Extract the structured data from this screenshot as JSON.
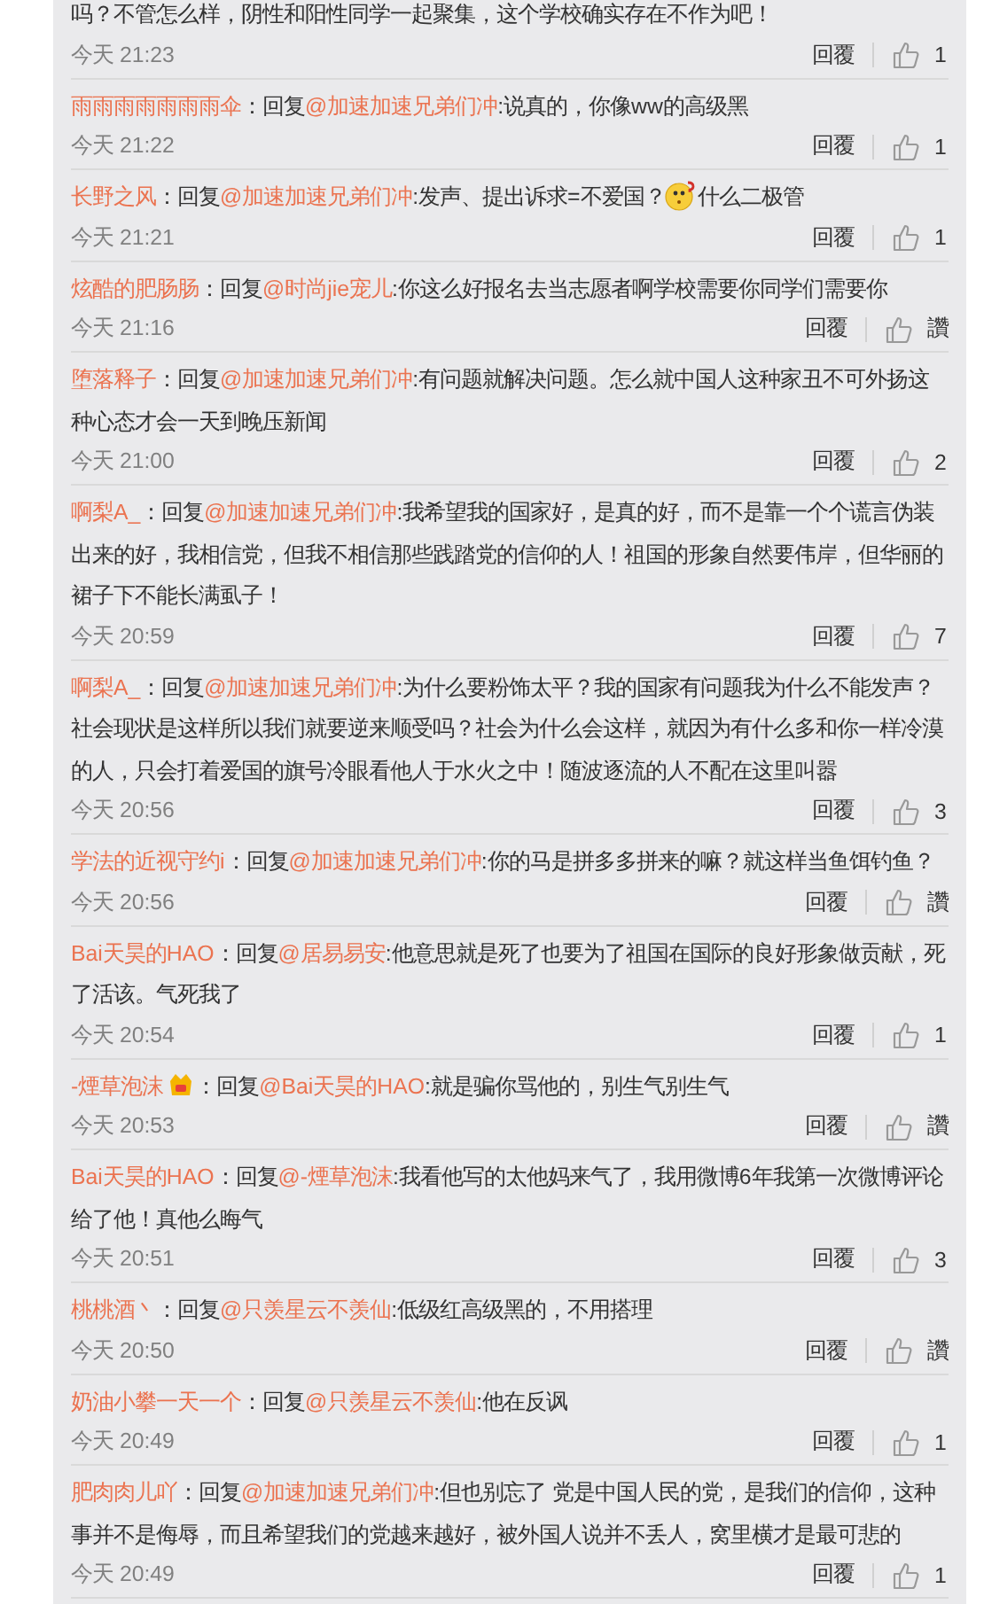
{
  "comments": [
    {
      "body": [
        {
          "kind": "text",
          "text": "吗？不管怎么样，阴性和阳性同学一起聚集，这个学校确实存在不作为吧！"
        }
      ],
      "time": "今天 21:23",
      "reply": "回覆",
      "likes": "1"
    },
    {
      "user": "雨雨雨雨雨雨雨伞",
      "user_badge": false,
      "prefix": "：回复",
      "mention": "@加速加速兄弟们冲",
      "body": [
        {
          "kind": "text",
          "text": ":说真的，你像ww的高级黑"
        }
      ],
      "time": "今天 21:22",
      "reply": "回覆",
      "likes": "1"
    },
    {
      "user": "长野之风",
      "user_badge": false,
      "prefix": "：回复",
      "mention": "@加速加速兄弟们冲",
      "body": [
        {
          "kind": "text",
          "text": ":发声、提出诉求=不爱国？"
        },
        {
          "kind": "emoticon"
        },
        {
          "kind": "text",
          "text": "什么二极管"
        }
      ],
      "time": "今天 21:21",
      "reply": "回覆",
      "likes": "1"
    },
    {
      "user": "炫酷的肥肠肠",
      "user_badge": false,
      "prefix": "：回复",
      "mention": "@时尚jie宠儿",
      "body": [
        {
          "kind": "text",
          "text": ":你这么好报名去当志愿者啊学校需要你同学们需要你"
        }
      ],
      "time": "今天 21:16",
      "reply": "回覆",
      "likes": "讚"
    },
    {
      "user": "堕落释子",
      "user_badge": false,
      "prefix": "：回复",
      "mention": "@加速加速兄弟们冲",
      "body": [
        {
          "kind": "text",
          "text": ":有问题就解决问题。怎么就中国人这种家丑不可外扬这种心态才会一天到晚压新闻"
        }
      ],
      "time": "今天 21:00",
      "reply": "回覆",
      "likes": "2"
    },
    {
      "user": "啊梨A_",
      "user_badge": false,
      "prefix": "：回复",
      "mention": "@加速加速兄弟们冲",
      "body": [
        {
          "kind": "text",
          "text": ":我希望我的国家好，是真的好，而不是靠一个个谎言伪装出来的好，我相信党，但我不相信那些践踏党的信仰的人！祖国的形象自然要伟岸，但华丽的裙子下不能长满虱子！"
        }
      ],
      "time": "今天 20:59",
      "reply": "回覆",
      "likes": "7"
    },
    {
      "user": "啊梨A_",
      "user_badge": false,
      "prefix": "：回复",
      "mention": "@加速加速兄弟们冲",
      "body": [
        {
          "kind": "text",
          "text": ":为什么要粉饰太平？我的国家有问题我为什么不能发声？社会现状是这样所以我们就要逆来顺受吗？社会为什么会这样，就因为有什么多和你一样冷漠的人，只会打着爱国的旗号冷眼看他人于水火之中！随波逐流的人不配在这里叫嚣"
        }
      ],
      "time": "今天 20:56",
      "reply": "回覆",
      "likes": "3"
    },
    {
      "user": "学法的近视守约i",
      "user_badge": false,
      "prefix": "：回复",
      "mention": "@加速加速兄弟们冲",
      "body": [
        {
          "kind": "text",
          "text": ":你的马是拼多多拼来的嘛？就这样当鱼饵钓鱼？"
        }
      ],
      "time": "今天 20:56",
      "reply": "回覆",
      "likes": "讚"
    },
    {
      "user": "Bai天昊的HAO",
      "user_badge": false,
      "prefix": "：回复",
      "mention": "@居易易安",
      "body": [
        {
          "kind": "text",
          "text": ":他意思就是死了也要为了祖国在国际的良好形象做贡献，死了活该。气死我了"
        }
      ],
      "time": "今天 20:54",
      "reply": "回覆",
      "likes": "1"
    },
    {
      "user": "-煙草泡沫",
      "user_badge": true,
      "prefix": "：回复",
      "mention": "@Bai天昊的HAO",
      "body": [
        {
          "kind": "text",
          "text": ":就是骗你骂他的，别生气别生气"
        }
      ],
      "time": "今天 20:53",
      "reply": "回覆",
      "likes": "讚"
    },
    {
      "user": "Bai天昊的HAO",
      "user_badge": false,
      "prefix": "：回复",
      "mention": "@-煙草泡沫",
      "body": [
        {
          "kind": "text",
          "text": ":我看他写的太他妈来气了，我用微博6年我第一次微博评论给了他！真他么晦气"
        }
      ],
      "time": "今天 20:51",
      "reply": "回覆",
      "likes": "3"
    },
    {
      "user": "桃桃酒丶",
      "user_badge": false,
      "prefix": "：回复",
      "mention": "@只羡星云不羡仙",
      "body": [
        {
          "kind": "text",
          "text": ":低级红高级黑的，不用搭理"
        }
      ],
      "time": "今天 20:50",
      "reply": "回覆",
      "likes": "讚"
    },
    {
      "user": "奶油小攀一天一个",
      "user_badge": false,
      "prefix": "：回复",
      "mention": "@只羡星云不羡仙",
      "body": [
        {
          "kind": "text",
          "text": ":他在反讽"
        }
      ],
      "time": "今天 20:49",
      "reply": "回覆",
      "likes": "1"
    },
    {
      "user": "肥肉肉儿吖",
      "user_badge": false,
      "prefix": "：回复",
      "mention": "@加速加速兄弟们冲",
      "body": [
        {
          "kind": "text",
          "text": ":但也别忘了 党是中国人民的党，是我们的信仰，这种事并不是侮辱，而且希望我们的党越来越好，被外国人说并不丢人，窝里横才是最可悲的"
        }
      ],
      "time": "今天 20:49",
      "reply": "回覆",
      "likes": "1"
    }
  ]
}
